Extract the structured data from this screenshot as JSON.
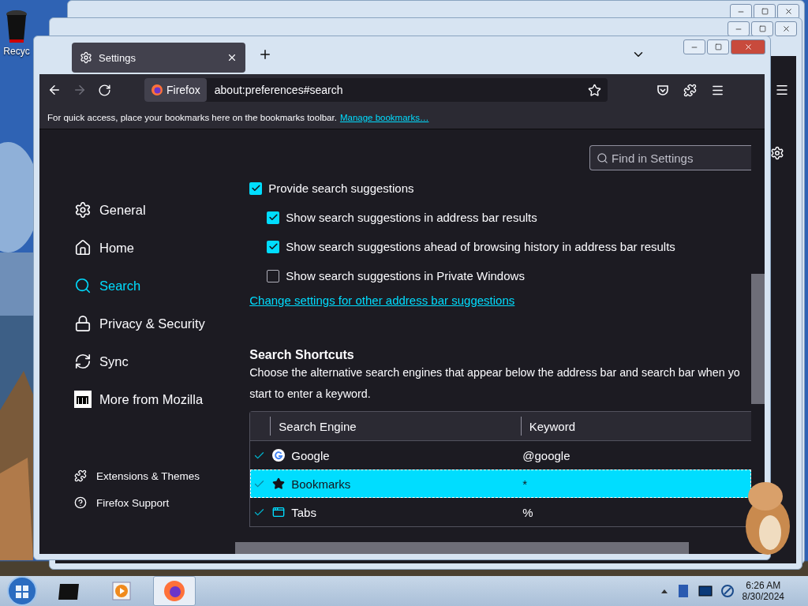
{
  "desktop": {
    "icons": [
      {
        "label": "Recyc"
      }
    ]
  },
  "window": {
    "tab": {
      "title": "Settings",
      "selected": true
    },
    "address_bar": {
      "identity": "Firefox",
      "url": "about:preferences#search"
    },
    "bookmarks_bar": {
      "text": "For quick access, place your bookmarks here on the bookmarks toolbar.",
      "link": "Manage bookmarks…"
    }
  },
  "settings": {
    "search": {
      "placeholder": "Find in Settings"
    },
    "nav": [
      {
        "label": "General",
        "kind": "gear",
        "selected": false
      },
      {
        "label": "Home",
        "kind": "home",
        "selected": false
      },
      {
        "label": "Search",
        "kind": "search",
        "selected": true
      },
      {
        "label": "Privacy & Security",
        "kind": "lock",
        "selected": false
      },
      {
        "label": "Sync",
        "kind": "sync",
        "selected": false
      },
      {
        "label": "More from Mozilla",
        "kind": "mozilla",
        "selected": false
      }
    ],
    "footer_links": [
      {
        "label": "Extensions & Themes",
        "kind": "puzzle"
      },
      {
        "label": "Firefox Support",
        "kind": "help"
      }
    ],
    "options": [
      {
        "label": "Provide search suggestions",
        "checked": true,
        "children": [
          {
            "label": "Show search suggestions in address bar results",
            "checked": true
          },
          {
            "label": "Show search suggestions ahead of browsing history in address bar results",
            "checked": true
          },
          {
            "label": "Show search suggestions in Private Windows",
            "checked": false
          }
        ]
      }
    ],
    "options_link": "Change settings for other address bar suggestions",
    "shortcuts": {
      "heading": "Search Shortcuts",
      "description_lines": [
        "Choose the alternative search engines that appear below the address bar and search bar when yo",
        "start to enter a keyword."
      ],
      "columns": [
        "Search Engine",
        "Keyword"
      ],
      "rows": [
        {
          "name": "Google",
          "kind": "google",
          "keyword": "@google",
          "enabled": true,
          "selected": false
        },
        {
          "name": "Bookmarks",
          "kind": "star",
          "keyword": "*",
          "enabled": true,
          "selected": true
        },
        {
          "name": "Tabs",
          "kind": "tab",
          "keyword": "%",
          "enabled": true,
          "selected": false
        }
      ]
    }
  },
  "taskbar": {
    "time": "6:26 AM",
    "date": "8/30/2024"
  }
}
